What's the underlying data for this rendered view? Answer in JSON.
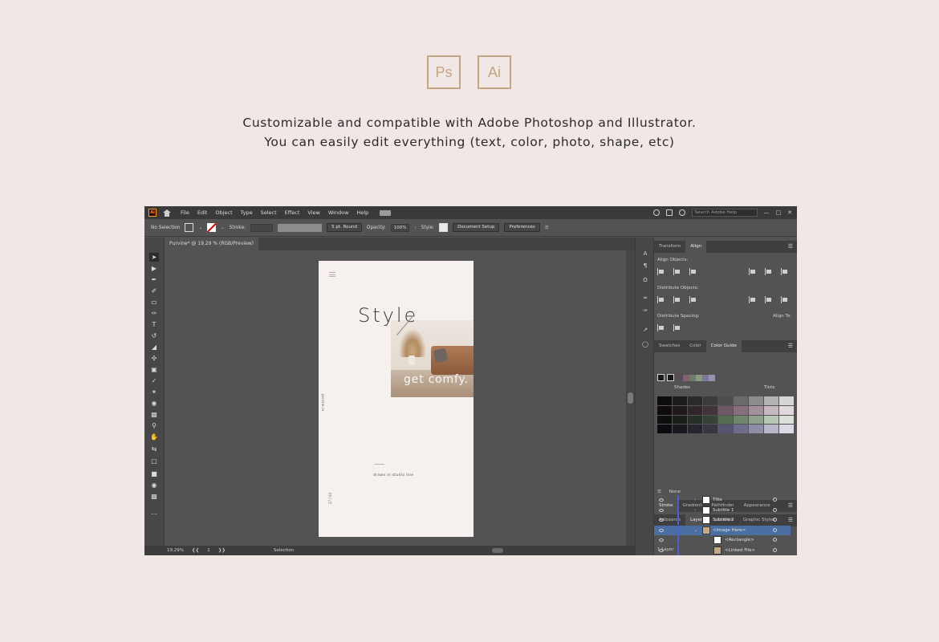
{
  "badges": [
    "Ps",
    "Ai"
  ],
  "headline": {
    "line1": "Customizable and compatible with Adobe Photoshop and Illustrator.",
    "line2": "You can easily edit everything (text, color, photo, shape, etc)"
  },
  "app": {
    "logo": "Ai",
    "menu": [
      "File",
      "Edit",
      "Object",
      "Type",
      "Select",
      "Effect",
      "View",
      "Window",
      "Help"
    ],
    "search_placeholder": "Search Adobe Help",
    "control": {
      "selection": "No Selection",
      "stroke_label": "Stroke:",
      "brush": "5 pt. Round",
      "opacity_label": "Opacity:",
      "opacity_value": "100%",
      "style_label": "Style:",
      "document_setup": "Document Setup",
      "preferences": "Preferences"
    },
    "doc_tab": "Purvine* @ 19,29 % (RGB/Preview)",
    "status": {
      "zoom": "19,29%",
      "page": "1",
      "tool": "Selection"
    }
  },
  "artboard": {
    "title": "Style",
    "overlay": "get comfy.",
    "vertical_1": "purvine.co",
    "caption": "drawn in studio line",
    "vertical_2": "27 / 03"
  },
  "panels": {
    "align_tabs": [
      "Transform",
      "Align"
    ],
    "align_objects": "Align Objects:",
    "distribute_objects": "Distribute Objects:",
    "distribute_spacing": "Distribute Spacing:",
    "align_to": "Align To:",
    "color_tabs": [
      "Swatches",
      "Color",
      "Color Guide"
    ],
    "shades": "Shades",
    "tints": "Tints",
    "none_label": "None",
    "stroke_tabs": [
      "Stroke",
      "Gradient",
      "Pathfinder",
      "Appearance"
    ],
    "layer_tabs": [
      "Artboards",
      "Layers",
      "Libraries",
      "Graphic Styles"
    ],
    "layers": [
      {
        "name": "Title",
        "selected": false,
        "sub": false
      },
      {
        "name": "Subtitle 1",
        "selected": false,
        "sub": false
      },
      {
        "name": "Subtitle 2",
        "selected": false,
        "sub": false
      },
      {
        "name": "<Image Here>",
        "selected": true,
        "sub": false
      },
      {
        "name": "<Rectangle>",
        "selected": false,
        "sub": true
      },
      {
        "name": "<Linked File>",
        "selected": false,
        "sub": true
      }
    ],
    "layers_count": "1 Layer"
  },
  "colors": {
    "accent": "#c4a584",
    "background": "#f1e7e4"
  }
}
